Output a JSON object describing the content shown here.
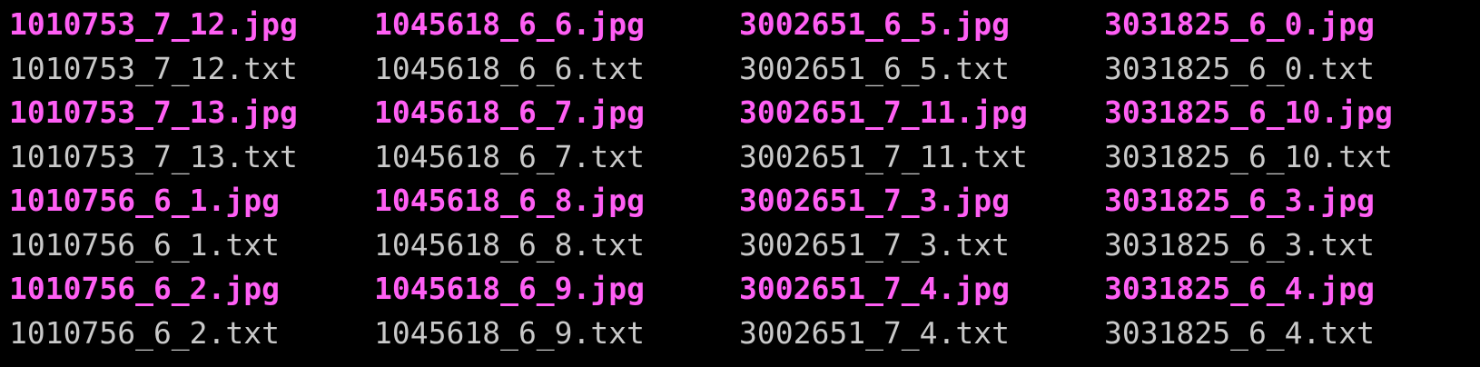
{
  "colors": {
    "background": "#000000",
    "image_file": "#ff5ff4",
    "text_file": "#c9c9c9"
  },
  "listing": {
    "columns": [
      {
        "files": [
          "1010753_7_12.jpg",
          "1010753_7_12.txt",
          "1010753_7_13.jpg",
          "1010753_7_13.txt",
          "1010756_6_1.jpg",
          "1010756_6_1.txt",
          "1010756_6_2.jpg",
          "1010756_6_2.txt"
        ]
      },
      {
        "files": [
          "1045618_6_6.jpg",
          "1045618_6_6.txt",
          "1045618_6_7.jpg",
          "1045618_6_7.txt",
          "1045618_6_8.jpg",
          "1045618_6_8.txt",
          "1045618_6_9.jpg",
          "1045618_6_9.txt"
        ]
      },
      {
        "files": [
          "3002651_6_5.jpg",
          "3002651_6_5.txt",
          "3002651_7_11.jpg",
          "3002651_7_11.txt",
          "3002651_7_3.jpg",
          "3002651_7_3.txt",
          "3002651_7_4.jpg",
          "3002651_7_4.txt"
        ]
      },
      {
        "files": [
          "3031825_6_0.jpg",
          "3031825_6_0.txt",
          "3031825_6_10.jpg",
          "3031825_6_10.txt",
          "3031825_6_3.jpg",
          "3031825_6_3.txt",
          "3031825_6_4.jpg",
          "3031825_6_4.txt"
        ]
      }
    ]
  }
}
